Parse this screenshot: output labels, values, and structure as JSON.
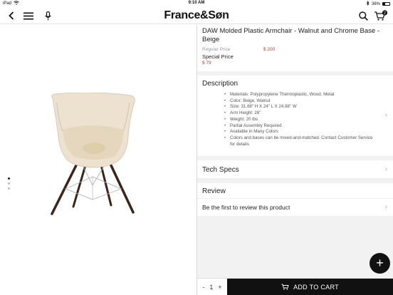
{
  "status_bar": {
    "device": "iPad",
    "time": "9:10 AM",
    "battery": "36%",
    "battery_level": 0.36
  },
  "header": {
    "logo": "France&Søn",
    "cart_count": "2"
  },
  "gallery": {
    "dot_count": 3,
    "active_index": 0
  },
  "product": {
    "title": "DAW Molded Plastic Armchair - Walnut and Chrome Base - Beige",
    "regular_price_label": "Regular Price",
    "regular_price": "$ 200",
    "special_price_label": "Special Price",
    "special_price": "$ 79"
  },
  "description": {
    "title": "Description",
    "items": [
      "Materials: Polypropylene Thermoplastic, Wood, Metal",
      "Color: Beige, Walnut",
      "Size: 31.88\" H X 24\" L X 24.88\" W",
      "Arm Height: 26\"",
      "Weight: 20 lbs",
      "Partial Assembly Required",
      "Available in Many Colors",
      "Colors and bases can be mixed-and-matched. Contact Customer Service for details"
    ]
  },
  "tech_specs": {
    "title": "Tech Specs"
  },
  "reviews": {
    "title": "Review",
    "cta": "Be the first to review this product"
  },
  "purchase": {
    "minus": "-",
    "quantity": "1",
    "plus": "+",
    "add_to_cart": "ADD TO CART",
    "fab": "+"
  },
  "colors": {
    "price_red": "#c0392b",
    "button_black": "#111111"
  }
}
